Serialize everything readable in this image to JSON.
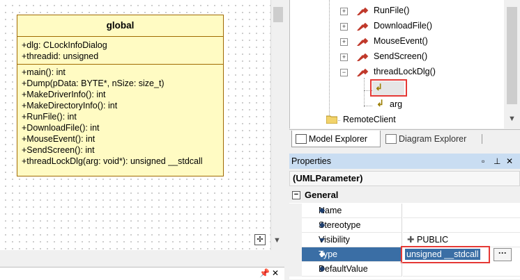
{
  "diagram": {
    "class_name": "global",
    "attributes": [
      "+dlg: CLockInfoDialog",
      "+threadid: unsigned"
    ],
    "operations": [
      "+main(): int",
      "+Dump(pData: BYTE*, nSize: size_t)",
      "+MakeDriverInfo(): int",
      "+MakeDirectoryInfo(): int",
      "+RunFile(): int",
      "+DownloadFile(): int",
      "+MouseEvent(): int",
      "+SendScreen(): int",
      "+threadLockDlg(arg: void*): unsigned __stdcall"
    ],
    "colors": {
      "class_fill": "#fffbc3",
      "class_border": "#a06a00"
    }
  },
  "tree": {
    "items": [
      {
        "label": "RunFile()"
      },
      {
        "label": "DownloadFile()"
      },
      {
        "label": "MouseEvent()"
      },
      {
        "label": "SendScreen()"
      },
      {
        "label": "threadLockDlg()"
      },
      {
        "label": ""
      },
      {
        "label": "arg"
      },
      {
        "label": "RemoteClient"
      }
    ]
  },
  "tabs": {
    "model": "Model Explorer",
    "diagram": "Diagram Explorer"
  },
  "properties": {
    "header": "Properties",
    "element_type": "(UMLParameter)",
    "section": "General",
    "rows": [
      {
        "name": "Name",
        "value": ""
      },
      {
        "name": "Stereotype",
        "value": ""
      },
      {
        "name": "Visibility",
        "value": "PUBLIC"
      },
      {
        "name": "Type",
        "value": "unsigned __stdcall"
      },
      {
        "name": "DefaultValue",
        "value": ""
      }
    ]
  },
  "highlight_color": "#e53935",
  "selection_color": "#3a6ea5"
}
